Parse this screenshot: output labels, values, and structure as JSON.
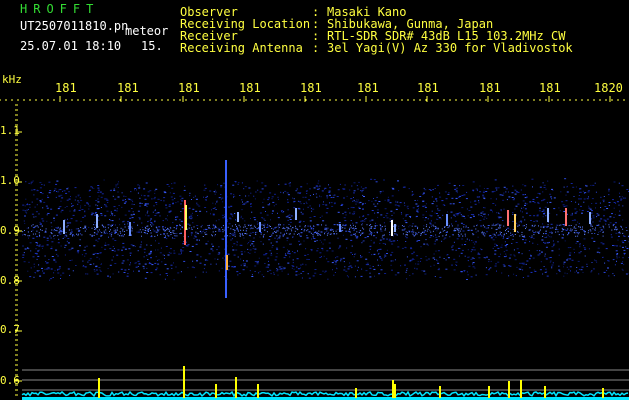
{
  "header": {
    "title": "HROFFT",
    "filename": "UT2507011810.pn",
    "mode": "meteor",
    "datetime": "25.07.01 18:10",
    "counter": "15."
  },
  "info": [
    {
      "label": "Observer",
      "sep": ":",
      "value": "Masaki Kano"
    },
    {
      "label": "Receiving Location",
      "sep": ":",
      "value": "Shibukawa, Gunma, Japan"
    },
    {
      "label": "Receiver",
      "sep": ":",
      "value": "RTL-SDR SDR# 43dB L15 103.2MHz CW"
    },
    {
      "label": "Receiving Antenna",
      "sep": ":",
      "value": "3el Yagi(V) Az 330 for Vladivostok"
    }
  ],
  "axis": {
    "unit": "kHz",
    "time_labels": [
      "181",
      "181",
      "181",
      "181",
      "181",
      "181",
      "181",
      "181",
      "181",
      "1820"
    ],
    "freq_labels": [
      "1.1",
      "1.0",
      "0.9",
      "0.8",
      "0.7",
      "0.6"
    ]
  },
  "colors": {
    "text_white": "#ffffff",
    "text_yellow": "#ffff40",
    "text_green": "#33dd33",
    "noise_band": "#1a2aa0",
    "signal_trace": "#00e5ff",
    "spike": "#ffff00"
  }
}
